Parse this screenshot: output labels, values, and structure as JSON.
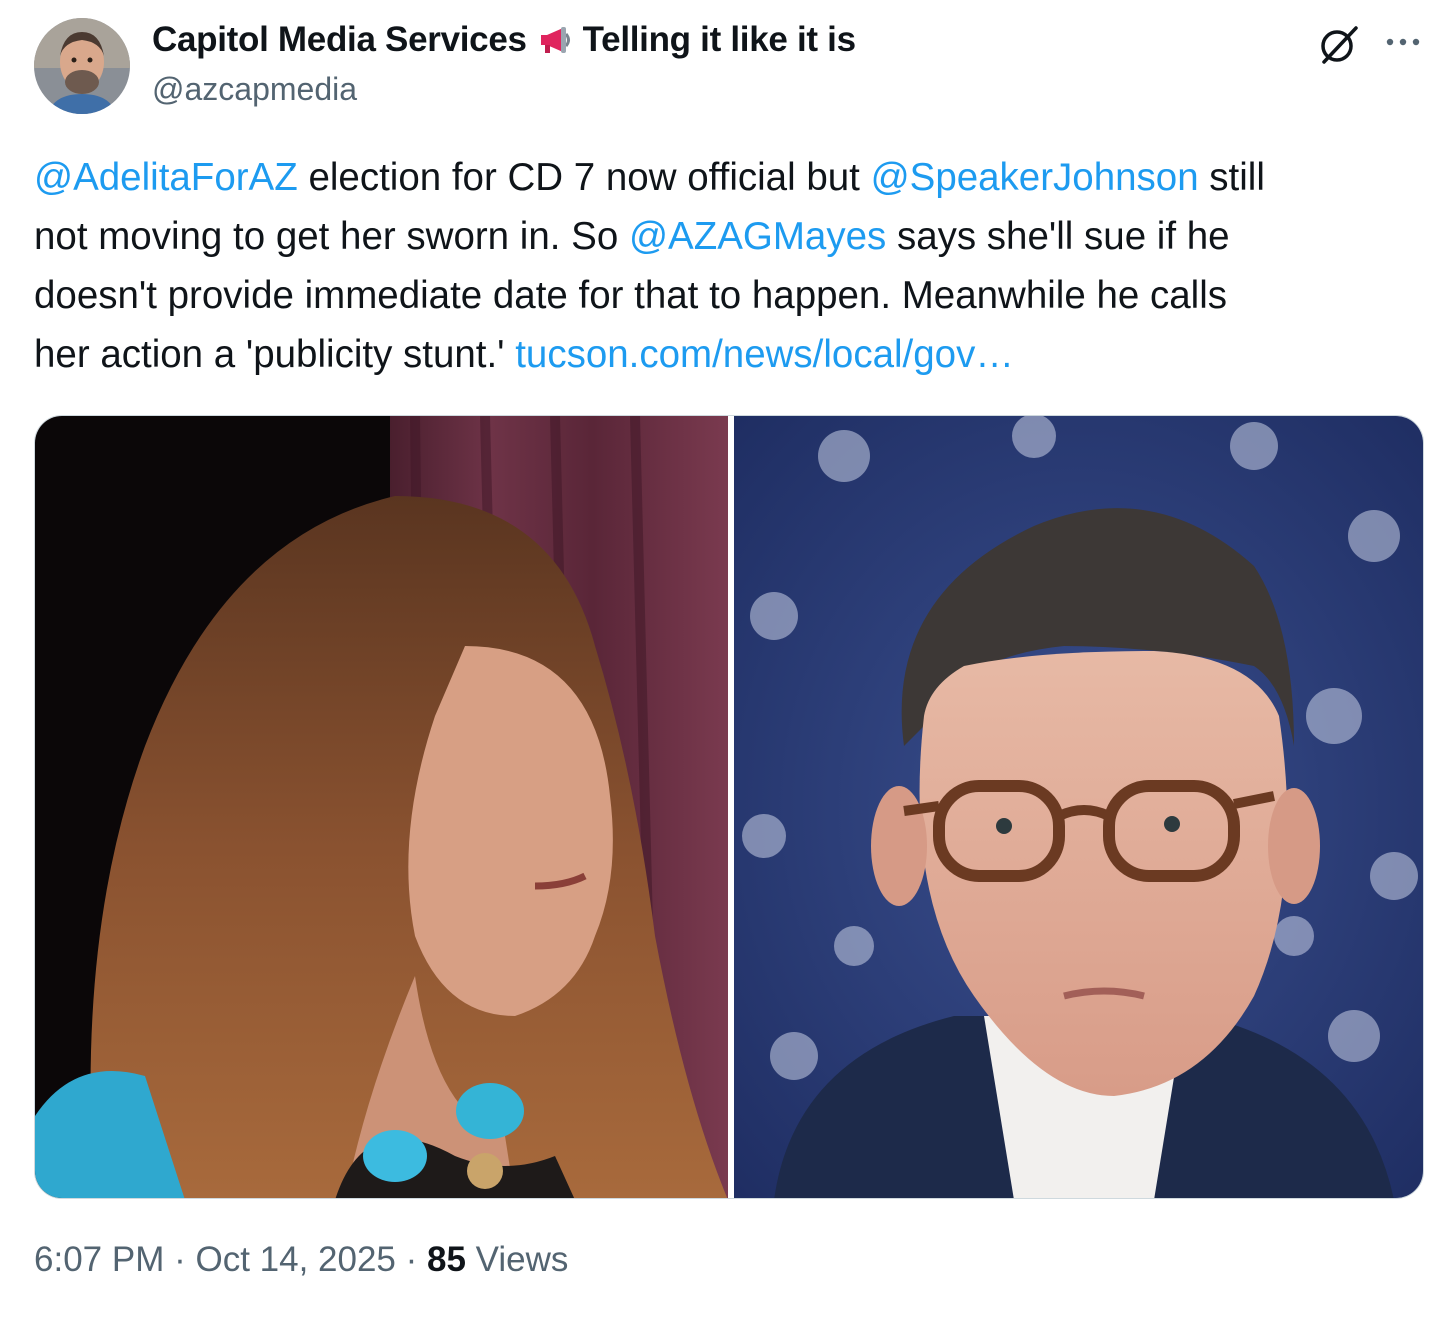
{
  "author": {
    "display_name": "Capitol Media Services",
    "name_suffix": "Telling it like it is",
    "handle": "@azcapmedia",
    "avatar_icon": "user-avatar"
  },
  "icons": {
    "grok": "grok-icon",
    "more": "more-icon",
    "megaphone": "megaphone-icon"
  },
  "tweet": {
    "line1": {
      "mention1": "@AdelitaForAZ",
      "text1": " election for CD 7 now official but ",
      "mention2": "@SpeakerJohnson",
      "text2": " still"
    },
    "line2": {
      "text1": "not moving to get her sworn in. So ",
      "mention": "@AZAGMayes",
      "text2": " says she'll sue if he"
    },
    "line3": "doesn't provide immediate date for that to happen. Meanwhile he calls",
    "line4": {
      "text": "her action a 'publicity stunt.' ",
      "link": "tucson.com/news/local/gov…"
    }
  },
  "media": {
    "photo_count": 2
  },
  "footer": {
    "time": "6:07 PM",
    "separator": " · ",
    "date": "Oct 14, 2025",
    "views_count": "85",
    "views_label": " Views"
  },
  "colors": {
    "link": "#1d9bf0",
    "text": "#0f1419",
    "secondary": "#536471",
    "megaphone": "#e0245e"
  }
}
